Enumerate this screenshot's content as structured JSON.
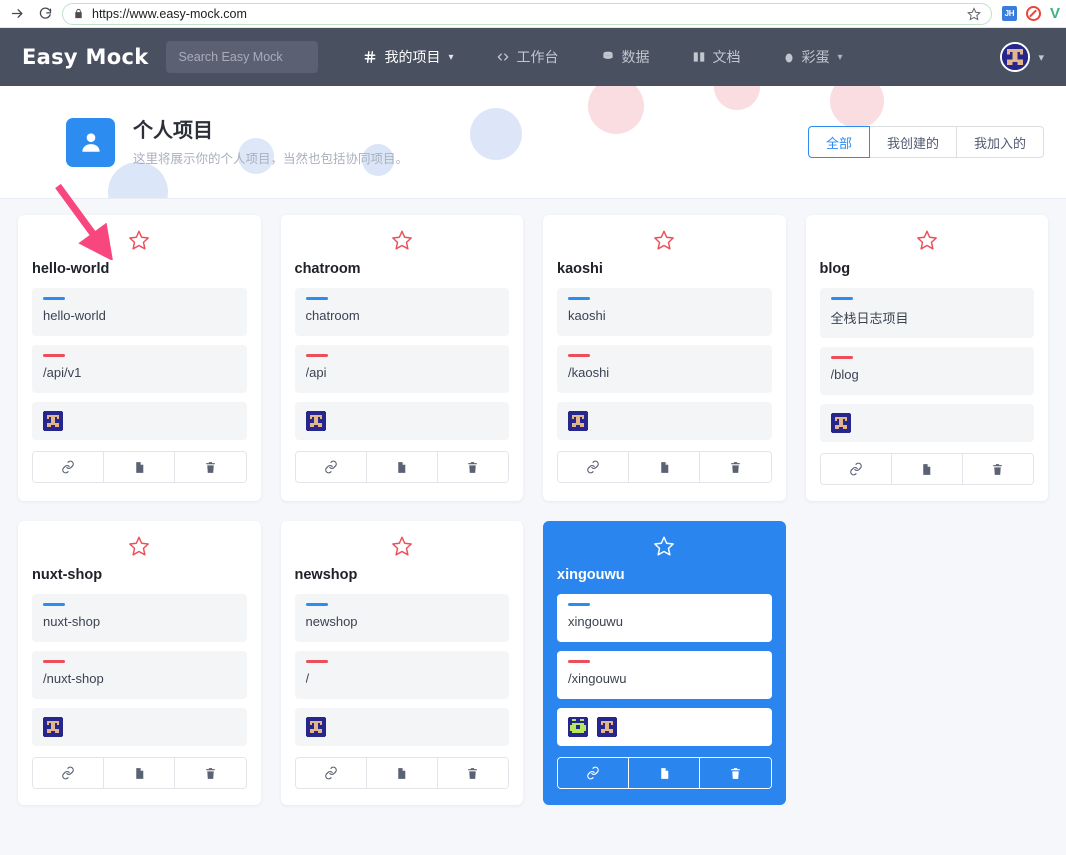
{
  "browser": {
    "url": "https://www.easy-mock.com",
    "forward_icon": "arrow-right-icon",
    "reload_icon": "reload-icon",
    "lock_icon": "lock-icon",
    "bookmark_icon": "star-outline-icon",
    "extensions": [
      {
        "name": "jh-extension",
        "label": "JH"
      },
      {
        "name": "adblock-extension",
        "label": ""
      },
      {
        "name": "vue-devtools-extension",
        "label": "V"
      }
    ]
  },
  "header": {
    "logo": "Easy Mock",
    "search_placeholder": "Search Easy Mock",
    "search_value": "",
    "nav": [
      {
        "label": "我的项目",
        "icon": "hash-icon",
        "caret": "⌄",
        "active": true
      },
      {
        "label": "工作台",
        "icon": "code-icon",
        "caret": "",
        "active": false
      },
      {
        "label": "数据",
        "icon": "database-icon",
        "caret": "",
        "active": false
      },
      {
        "label": "文档",
        "icon": "book-icon",
        "caret": "",
        "active": false
      },
      {
        "label": "彩蛋",
        "icon": "egg-icon",
        "caret": "⌄",
        "active": false
      }
    ],
    "user_avatar": "user-avatar-icon",
    "user_caret": "⌄",
    "bg_color": "#495060"
  },
  "hero": {
    "icon": "person-icon",
    "icon_bg": "#2d8cf0",
    "title": "个人项目",
    "subtitle": "这里将展示你的个人项目，当然也包括协同项目。",
    "filters": [
      {
        "label": "全部",
        "active": true
      },
      {
        "label": "我创建的",
        "active": false
      },
      {
        "label": "我加入的",
        "active": false
      }
    ],
    "decor_blue": "#dae5f7",
    "decor_pink": "#f9dde1"
  },
  "annotation": {
    "arrow_color": "#f8467e",
    "target": "hello-world"
  },
  "colors": {
    "accent_blue": "#2d8cf0",
    "accent_red": "#ed4f5a",
    "selected_card_bg": "#2b85ee",
    "page_bg": "#f5f7fa",
    "star_color": "#ed4f5a"
  },
  "actions": {
    "link_label": "link-icon",
    "copy_label": "copy-icon",
    "delete_label": "trash-icon"
  },
  "projects": [
    {
      "title": "hello-world",
      "name": "hello-world",
      "path": "/api/v1",
      "starred": false,
      "selected": false,
      "members": [
        "member-avatar-blue"
      ]
    },
    {
      "title": "chatroom",
      "name": "chatroom",
      "path": "/api",
      "starred": false,
      "selected": false,
      "members": [
        "member-avatar-blue"
      ]
    },
    {
      "title": "kaoshi",
      "name": "kaoshi",
      "path": "/kaoshi",
      "starred": false,
      "selected": false,
      "members": [
        "member-avatar-blue"
      ]
    },
    {
      "title": "blog",
      "name": "全栈日志项目",
      "path": "/blog",
      "starred": false,
      "selected": false,
      "members": [
        "member-avatar-blue"
      ]
    },
    {
      "title": "nuxt-shop",
      "name": "nuxt-shop",
      "path": "/nuxt-shop",
      "starred": false,
      "selected": false,
      "members": [
        "member-avatar-blue"
      ]
    },
    {
      "title": "newshop",
      "name": "newshop",
      "path": "/",
      "starred": false,
      "selected": false,
      "members": [
        "member-avatar-blue"
      ]
    },
    {
      "title": "xingouwu",
      "name": "xingouwu",
      "path": "/xingouwu",
      "starred": false,
      "selected": true,
      "members": [
        "member-avatar-green",
        "member-avatar-blue"
      ]
    }
  ]
}
